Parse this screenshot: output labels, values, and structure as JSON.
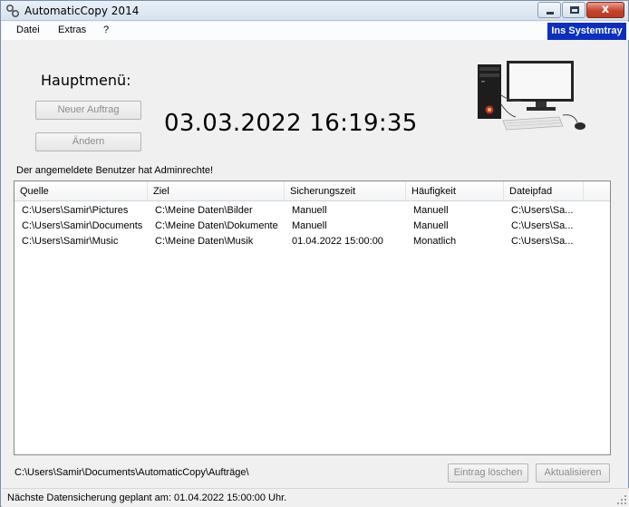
{
  "window": {
    "title": "AutomaticCopy 2014",
    "minimize_icon": "minimize-icon",
    "maximize_icon": "maximize-icon",
    "close_icon": "close-icon",
    "close_glyph": "x"
  },
  "menu": {
    "items": [
      "Datei",
      "Extras",
      "?"
    ],
    "systray_label": "Ins Systemtray",
    "systray_color": "#0c2fbf"
  },
  "main": {
    "title": "Hauptmenü:",
    "new_job_label": "Neuer Auftrag",
    "edit_label": "Ändern",
    "clock": "03.03.2022 16:19:35",
    "admin_note": "Der angemeldete Benutzer hat Adminrechte!",
    "illustration_icon": "computer-icon"
  },
  "table": {
    "columns": [
      "Quelle",
      "Ziel",
      "Sicherungszeit",
      "Häufigkeit",
      "Dateipfad"
    ],
    "rows": [
      [
        "C:\\Users\\Samir\\Pictures",
        "C:\\Meine Daten\\Bilder",
        "Manuell",
        "Manuell",
        "C:\\Users\\Sa..."
      ],
      [
        "C:\\Users\\Samir\\Documents",
        "C:\\Meine Daten\\Dokumente",
        "Manuell",
        "Manuell",
        "C:\\Users\\Sa..."
      ],
      [
        "C:\\Users\\Samir\\Music",
        "C:\\Meine Daten\\Musik",
        "01.04.2022 15:00:00",
        "Monatlich",
        "C:\\Users\\Sa..."
      ]
    ]
  },
  "footer": {
    "path": "C:\\Users\\Samir\\Documents\\AutomaticCopy\\Aufträge\\",
    "delete_label": "Eintrag löschen",
    "refresh_label": "Aktualisieren"
  },
  "status": {
    "text": "Nächste Datensicherung geplant am: 01.04.2022 15:00:00 Uhr."
  }
}
